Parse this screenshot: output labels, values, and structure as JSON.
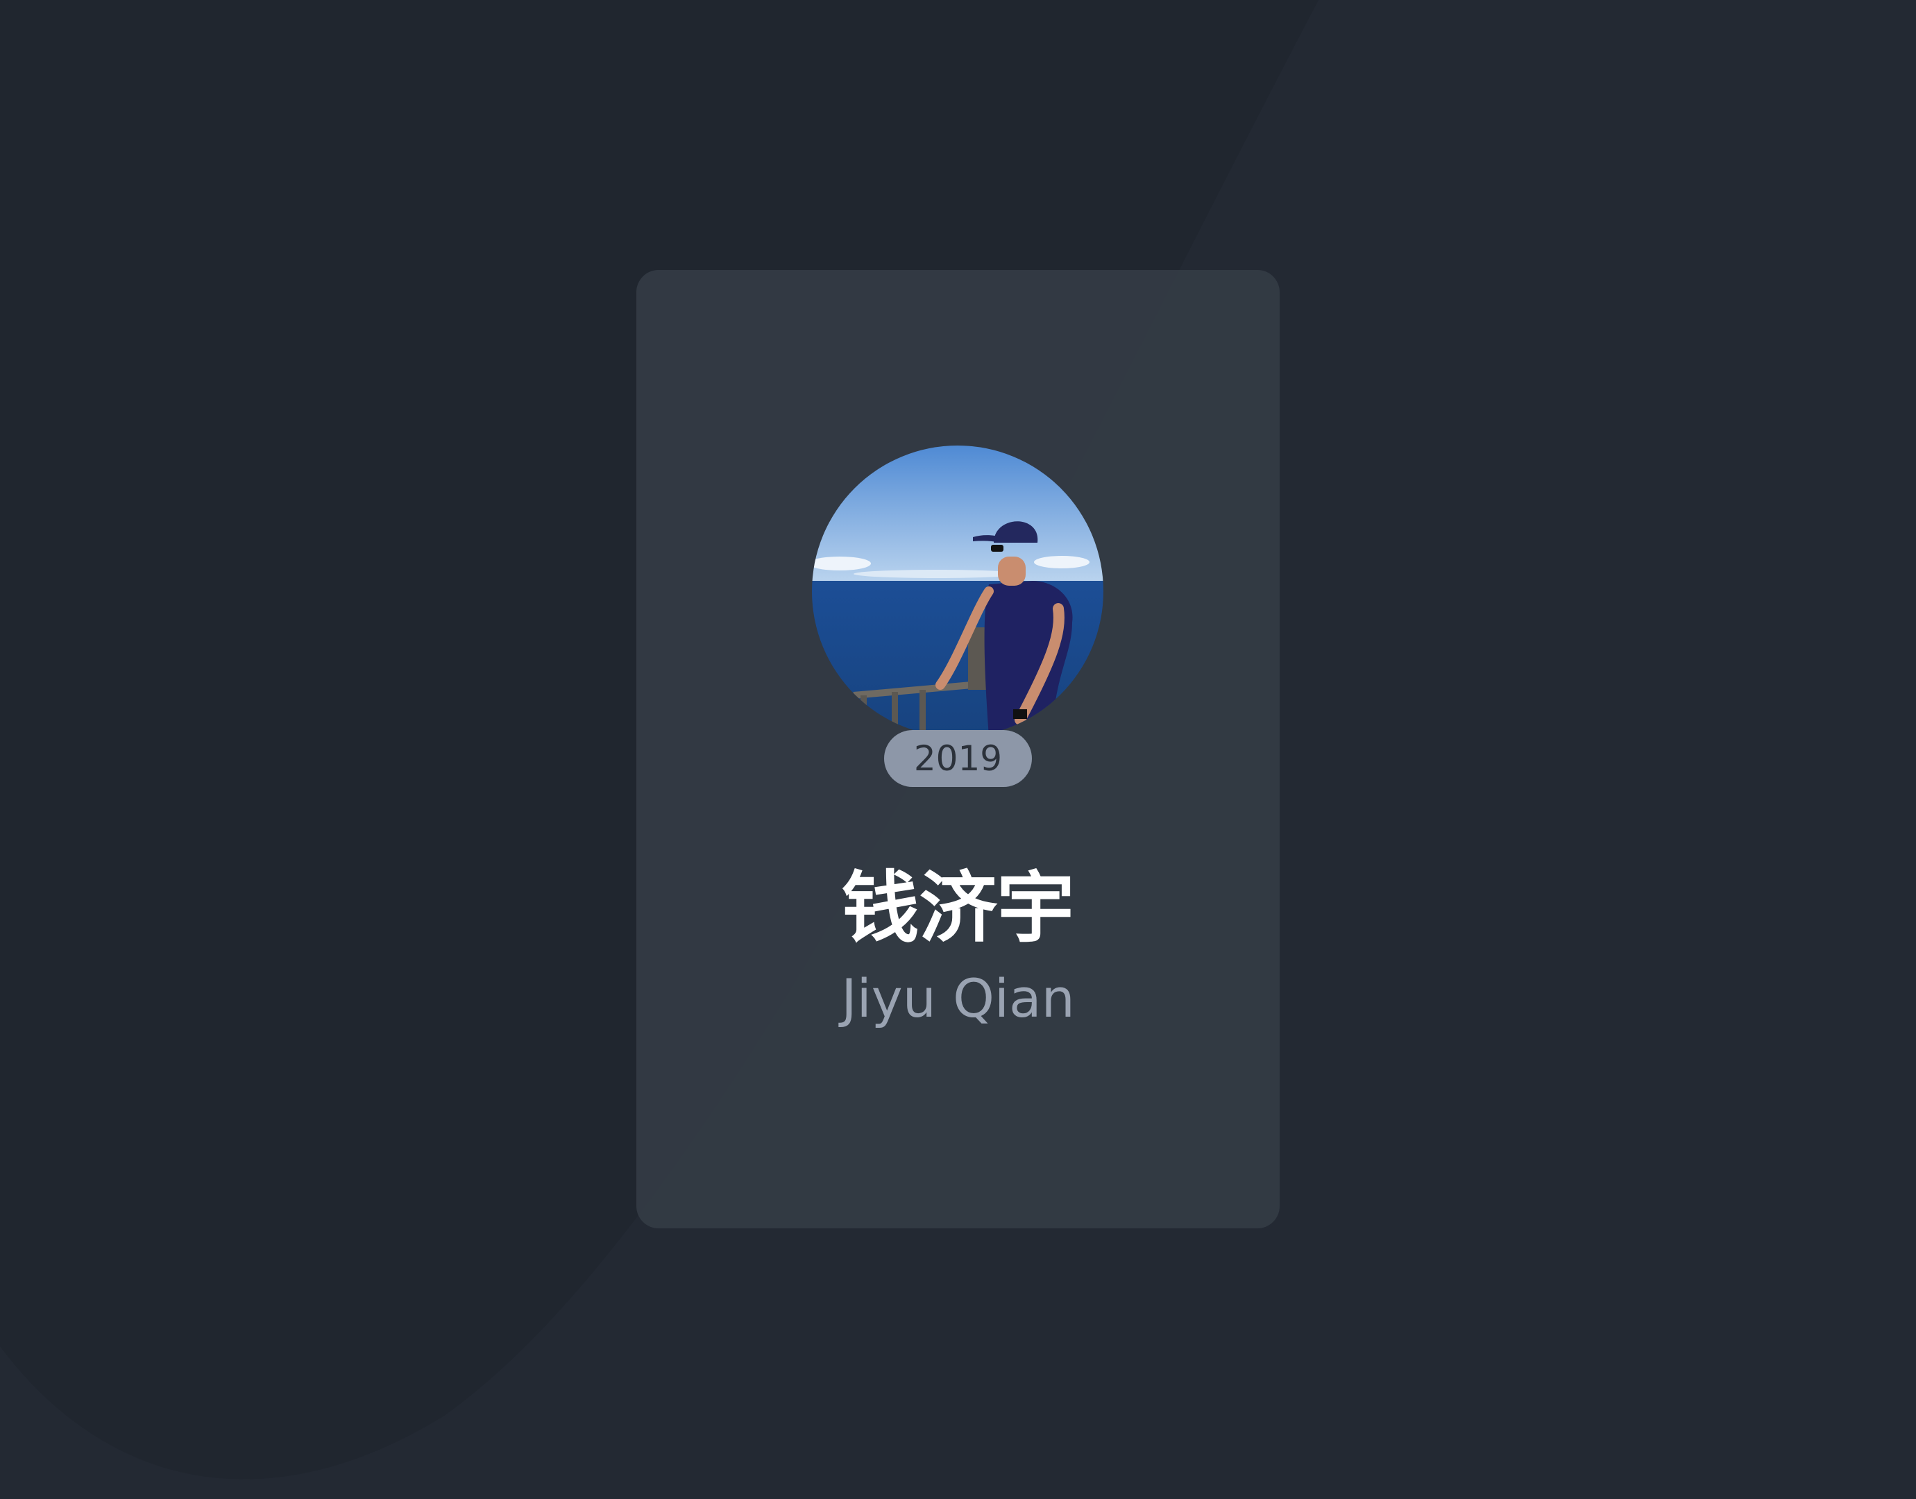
{
  "profile": {
    "year": "2019",
    "name_cn": "钱济宇",
    "name_en": "Jiyu Qian",
    "avatar_description": "avatar-photo"
  },
  "colors": {
    "background": "#232933",
    "card": "#343B45",
    "badge": "#8D97A8",
    "name_primary": "#FFFFFF",
    "name_secondary": "#9AA3B2"
  }
}
